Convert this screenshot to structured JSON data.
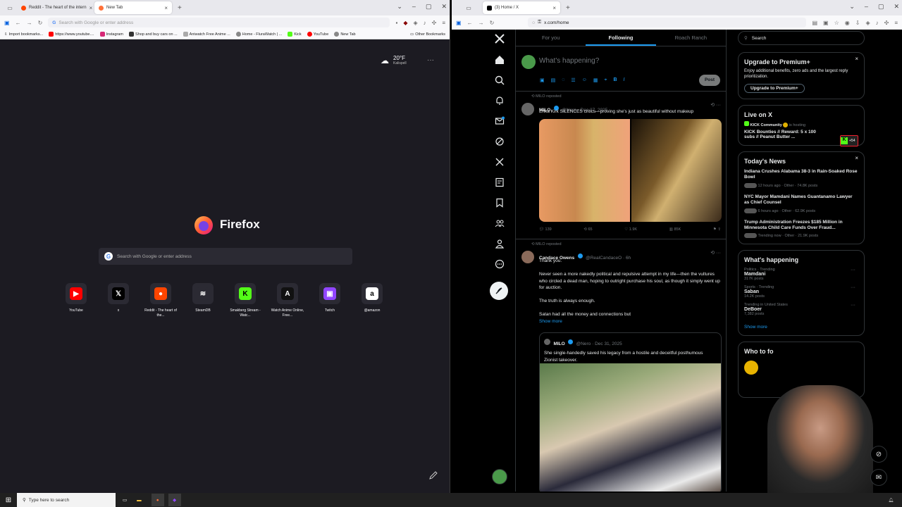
{
  "left_browser": {
    "tabs": [
      {
        "title": "Reddit - The heart of the intern",
        "fav": "#ff4500"
      },
      {
        "title": "New Tab",
        "fav": "#ff7139"
      }
    ],
    "url_placeholder": "Search with Google or enter address",
    "bookmarks": [
      "Import bookmarks...",
      "https://www.youtube....",
      "Instagram",
      "Shop and buy cars on ...",
      "Aniwatch Free Anime ...",
      "Home - FluraWatch | ...",
      "Kick",
      "YouTube",
      "New Tab"
    ],
    "other_bookmarks": "Other Bookmarks",
    "weather": {
      "temp": "20°F",
      "city": "Kalispell"
    },
    "brand": "Firefox",
    "search_placeholder": "Search with Google or enter address",
    "shortcuts": [
      {
        "label": "YouTube",
        "icon": "youtube-icon",
        "color": "#ff0000",
        "glyph": "▶"
      },
      {
        "label": "x",
        "icon": "x-icon",
        "color": "#000000",
        "glyph": "𝕏"
      },
      {
        "label": "Reddit - The heart of the...",
        "icon": "reddit-icon",
        "color": "#ff4500",
        "glyph": "●"
      },
      {
        "label": "SteamDB",
        "icon": "steamdb-icon",
        "color": "#2b2a33",
        "glyph": "≋"
      },
      {
        "label": "Smakberg Stream - Watc...",
        "icon": "kick-icon",
        "color": "#53fc18",
        "glyph": "K"
      },
      {
        "label": "Watch Anime Online, Free...",
        "icon": "anime-icon",
        "color": "#111111",
        "glyph": "A"
      },
      {
        "label": "Twitch",
        "icon": "twitch-icon",
        "color": "#9146ff",
        "glyph": "▣"
      },
      {
        "label": "@amazon",
        "icon": "amazon-icon",
        "color": "#ffffff",
        "glyph": "a"
      }
    ]
  },
  "right_browser": {
    "tab_title": "(3) Home / X",
    "url": "x.com/home",
    "feed_tabs": [
      "For you",
      "Following",
      "Roach Ranch"
    ],
    "compose_placeholder": "What's happening?",
    "post_button": "Post",
    "tweet1": {
      "repost": "MILO reposted",
      "name": "MILO",
      "meta": "@Nero · Dec 27, 2025",
      "text": "Erika Kirk SILENCES critics—proving she's just as beautiful without makeup",
      "stats": [
        "139",
        "65",
        "1.9K",
        "85K"
      ]
    },
    "tweet2": {
      "repost": "MILO reposted",
      "name": "Candace Owens",
      "meta": "@RealCandaceO · 6h",
      "text1": "Thank you.",
      "text2": "Never seen a more nakedly political and repulsive attempt in my life—then the vultures who circled a dead man, hoping to outright purchase his soul, as though it simply went up for auction.",
      "text3": "The truth is always enough.",
      "text4": "Satan had all the money and connections but",
      "show_more": "Show more",
      "quote": {
        "name": "MILO",
        "meta": "@Nero · Dec 31, 2025",
        "text": "She single-handedly saved his legacy from a hostile and deceitful posthumous Zionist takeover."
      }
    },
    "search_placeholder": "Search",
    "premium": {
      "title": "Upgrade to Premium+",
      "body": "Enjoy additional benefits, zero ads and the largest reply prioritization.",
      "button": "Upgrade to Premium+"
    },
    "live": {
      "title": "Live on X",
      "host": "KICK Community",
      "status": "is hosting",
      "stream": "KICK Bounties // Reward: 5 x 100 subs // Peanut Butter ...",
      "count": "+54"
    },
    "news": {
      "title": "Today's News",
      "items": [
        {
          "headline": "Indiana Crushes Alabama 38-3 in Rain-Soaked Rose Bowl",
          "meta": "12 hours ago · Other · 74.8K posts"
        },
        {
          "headline": "NYC Mayor Mamdani Names Guantanamo Lawyer as Chief Counsel",
          "meta": "6 hours ago · Other · 62.9K posts"
        },
        {
          "headline": "Trump Administration Freezes $185 Million in Minnesota Child Care Funds Over Fraud...",
          "meta": "Trending now · Other · 21.9K posts"
        }
      ]
    },
    "happening": {
      "title": "What's happening",
      "items": [
        {
          "top": "Politics · Trending",
          "name": "Mamdani",
          "posts": "317K posts"
        },
        {
          "top": "Sports · Trending",
          "name": "Saban",
          "posts": "14.2K posts"
        },
        {
          "top": "Trending in United States",
          "name": "DeBoer",
          "posts": "7,382 posts"
        }
      ],
      "show_more": "Show more"
    },
    "who_to_follow": "Who to fo"
  },
  "taskbar": {
    "search_placeholder": "Type here to search"
  }
}
